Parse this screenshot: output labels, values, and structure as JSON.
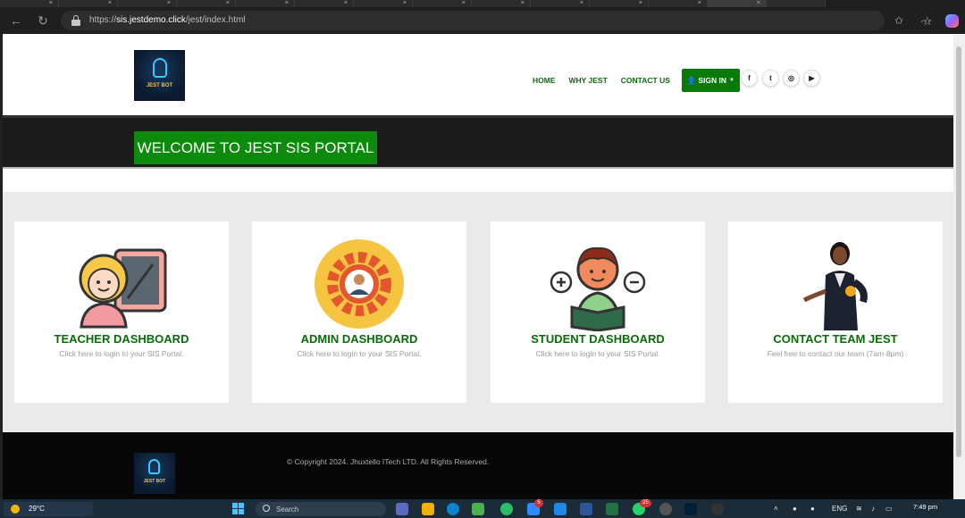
{
  "browser": {
    "url_scheme": "https://",
    "url_domain": "sis.jestdemo.click",
    "url_path": "/jest/index.html"
  },
  "site": {
    "logo_text": "JEST BOT",
    "nav": {
      "home": "HOME",
      "why": "WHY JEST",
      "contact": "CONTACT US",
      "signin": "SIGN IN"
    },
    "social": [
      "f",
      "t",
      "ig",
      "yt"
    ],
    "banner_title": "WELCOME TO JEST SIS PORTAL",
    "accent_color": "#077a07",
    "cards": [
      {
        "title": "TEACHER DASHBOARD",
        "desc": "Click here to login to your SIS Portal."
      },
      {
        "title": "ADMIN DASHBOARD",
        "desc": "Click here to login to your SIS Portal."
      },
      {
        "title": "STUDENT DASHBOARD",
        "desc": "Click here to login to your SIS Portal."
      },
      {
        "title": "CONTACT TEAM JEST",
        "desc": "Feel free to contact our team (7am-8pm)"
      }
    ],
    "footer": {
      "logo_text": "JEST BOT",
      "copyright": "© Copyright 2024. Jhuxtello ITech LTD. All Rights Reserved."
    }
  },
  "taskbar": {
    "weather": "29°C",
    "search_placeholder": "Search",
    "badges": [
      "5",
      "25"
    ],
    "lang": "ENG",
    "time": "7:49 pm"
  }
}
